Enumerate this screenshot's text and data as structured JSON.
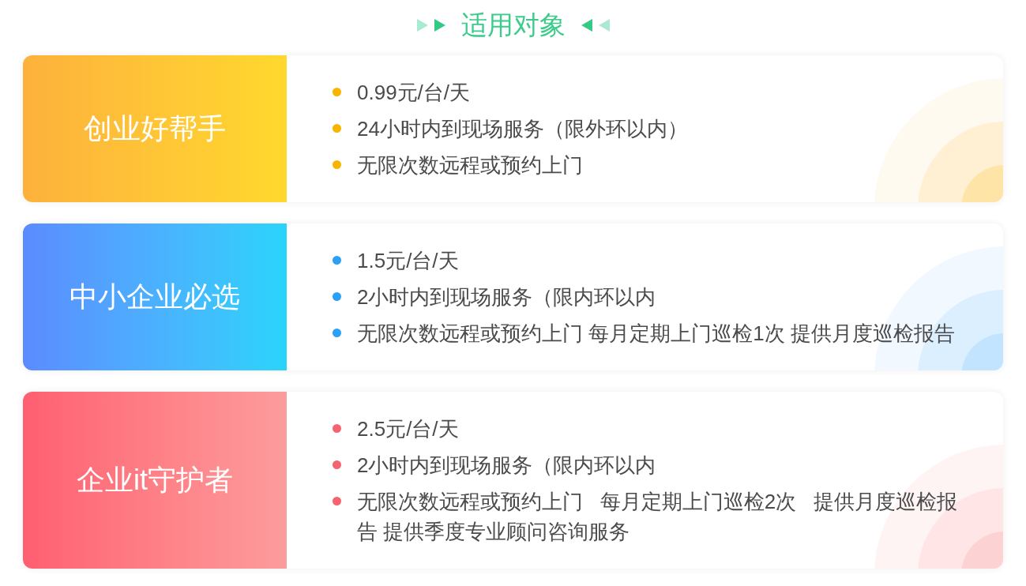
{
  "header": {
    "title": "适用对象"
  },
  "plans": [
    {
      "name": "创业好帮手",
      "color": "#f7b500",
      "features": [
        "0.99元/台/天",
        "24小时内到现场服务（限外环以内）",
        "无限次数远程或预约上门"
      ]
    },
    {
      "name": "中小企业必选",
      "color": "#2aa1f5",
      "features": [
        "1.5元/台/天",
        "2小时内到现场服务（限内环以内",
        "无限次数远程或预约上门 每月定期上门巡检1次 提供月度巡检报告"
      ]
    },
    {
      "name": "企业it守护者",
      "color": "#f4636f",
      "features": [
        "2.5元/台/天",
        "2小时内到现场服务（限内环以内",
        "无限次数远程或预约上门   每月定期上门巡检2次   提供月度巡检报告 提供季度专业顾问咨询服务"
      ]
    }
  ]
}
